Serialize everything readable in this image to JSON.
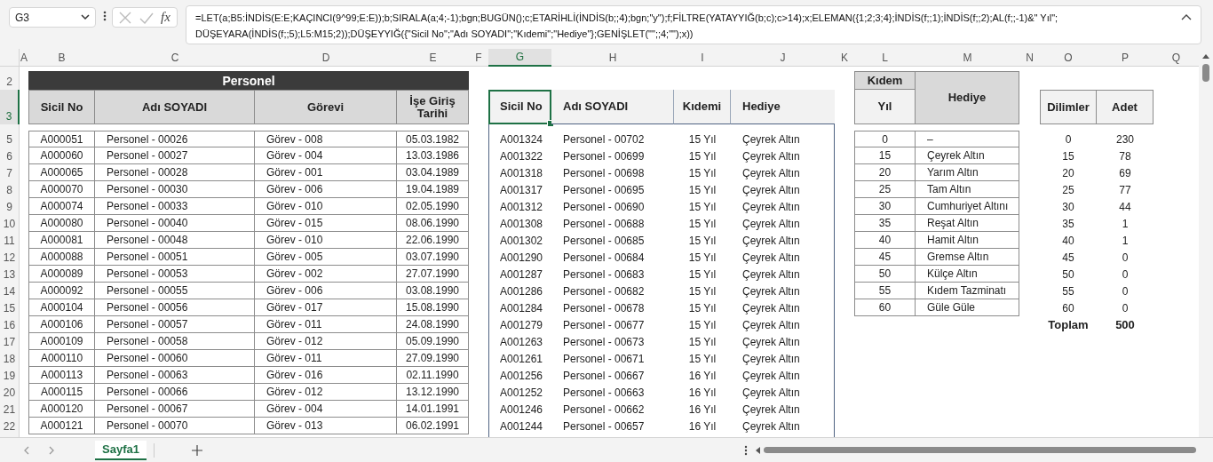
{
  "name_box": "G3",
  "function_label": "fx",
  "formula_lines": [
    "=LET(a;B5:İNDİS(E:E;KAÇINCI(9^99;E:E));b;SIRALA(a;4;-1);bgn;BUGÜN();c;ETARİHLİ(İNDİS(b;;4);bgn;\"y\");f;FİLTRE(YATAYYIĞ(b;c);c>14);x;ELEMAN({1;2;3;4};İNDİS(f;;1);İNDİS(f;;2);AL(f;;-1)&\" Yıl\";",
    "DÜŞEYARA(İNDİS(f;;5);L5:M15;2));DÜŞEYYIĞ({\"Sicil No\";\"Adı SOYADI\";\"Kıdemi\";\"Hediye\"};GENİŞLET(\"\";;4;\"\");x))"
  ],
  "columns": [
    {
      "label": "A",
      "selected": false
    },
    {
      "label": "B",
      "selected": false
    },
    {
      "label": "C",
      "selected": false
    },
    {
      "label": "D",
      "selected": false
    },
    {
      "label": "E",
      "selected": false
    },
    {
      "label": "F",
      "selected": false
    },
    {
      "label": "G",
      "selected": true
    },
    {
      "label": "H",
      "selected": false
    },
    {
      "label": "I",
      "selected": false
    },
    {
      "label": "J",
      "selected": false
    },
    {
      "label": "K",
      "selected": false
    },
    {
      "label": "L",
      "selected": false
    },
    {
      "label": "M",
      "selected": false
    },
    {
      "label": "N",
      "selected": false
    },
    {
      "label": "O",
      "selected": false
    },
    {
      "label": "P",
      "selected": false
    },
    {
      "label": "Q",
      "selected": false
    }
  ],
  "rows": [
    {
      "label": "2",
      "selected": false
    },
    {
      "label": "3",
      "selected": true
    },
    {
      "label": "5",
      "selected": false
    },
    {
      "label": "6",
      "selected": false
    },
    {
      "label": "7",
      "selected": false
    },
    {
      "label": "8",
      "selected": false
    },
    {
      "label": "9",
      "selected": false
    },
    {
      "label": "10",
      "selected": false
    },
    {
      "label": "11",
      "selected": false
    },
    {
      "label": "12",
      "selected": false
    },
    {
      "label": "13",
      "selected": false
    },
    {
      "label": "14",
      "selected": false
    },
    {
      "label": "15",
      "selected": false
    },
    {
      "label": "16",
      "selected": false
    },
    {
      "label": "17",
      "selected": false
    },
    {
      "label": "18",
      "selected": false
    },
    {
      "label": "19",
      "selected": false
    },
    {
      "label": "20",
      "selected": false
    },
    {
      "label": "21",
      "selected": false
    },
    {
      "label": "22",
      "selected": false
    }
  ],
  "personel": {
    "title": "Personel",
    "headers": [
      "Sicil No",
      "Adı SOYADI",
      "Görevi",
      "İşe Giriş Tarihi"
    ],
    "rows": [
      [
        "A000051",
        "Personel - 00026",
        "Görev - 008",
        "05.03.1982"
      ],
      [
        "A000060",
        "Personel - 00027",
        "Görev - 004",
        "13.03.1986"
      ],
      [
        "A000065",
        "Personel - 00028",
        "Görev - 001",
        "03.04.1989"
      ],
      [
        "A000070",
        "Personel - 00030",
        "Görev - 006",
        "19.04.1989"
      ],
      [
        "A000074",
        "Personel - 00033",
        "Görev - 010",
        "02.05.1990"
      ],
      [
        "A000080",
        "Personel - 00040",
        "Görev - 015",
        "08.06.1990"
      ],
      [
        "A000081",
        "Personel - 00048",
        "Görev - 010",
        "22.06.1990"
      ],
      [
        "A000088",
        "Personel - 00051",
        "Görev - 005",
        "03.07.1990"
      ],
      [
        "A000089",
        "Personel - 00053",
        "Görev - 002",
        "27.07.1990"
      ],
      [
        "A000092",
        "Personel - 00055",
        "Görev - 006",
        "03.08.1990"
      ],
      [
        "A000104",
        "Personel - 00056",
        "Görev - 017",
        "15.08.1990"
      ],
      [
        "A000106",
        "Personel - 00057",
        "Görev - 011",
        "24.08.1990"
      ],
      [
        "A000109",
        "Personel - 00058",
        "Görev - 012",
        "05.09.1990"
      ],
      [
        "A000110",
        "Personel - 00060",
        "Görev - 011",
        "27.09.1990"
      ],
      [
        "A000113",
        "Personel - 00063",
        "Görev - 016",
        "02.11.1990"
      ],
      [
        "A000115",
        "Personel - 00066",
        "Görev - 012",
        "13.12.1990"
      ],
      [
        "A000120",
        "Personel - 00067",
        "Görev - 004",
        "14.01.1991"
      ],
      [
        "A000121",
        "Personel - 00070",
        "Görev - 013",
        "06.02.1991"
      ]
    ]
  },
  "results": {
    "headers": [
      {
        "label": "Sicil No",
        "selected": true
      },
      {
        "label": "Adı SOYADI",
        "selected": false
      },
      {
        "label": "Kıdemi",
        "selected": false
      },
      {
        "label": "Hediye",
        "selected": false
      }
    ],
    "rows": [
      [
        "A001324",
        "Personel - 00702",
        "15 Yıl",
        "Çeyrek Altın"
      ],
      [
        "A001322",
        "Personel - 00699",
        "15 Yıl",
        "Çeyrek Altın"
      ],
      [
        "A001318",
        "Personel - 00698",
        "15 Yıl",
        "Çeyrek Altın"
      ],
      [
        "A001317",
        "Personel - 00695",
        "15 Yıl",
        "Çeyrek Altın"
      ],
      [
        "A001312",
        "Personel - 00690",
        "15 Yıl",
        "Çeyrek Altın"
      ],
      [
        "A001308",
        "Personel - 00688",
        "15 Yıl",
        "Çeyrek Altın"
      ],
      [
        "A001302",
        "Personel - 00685",
        "15 Yıl",
        "Çeyrek Altın"
      ],
      [
        "A001290",
        "Personel - 00684",
        "15 Yıl",
        "Çeyrek Altın"
      ],
      [
        "A001287",
        "Personel - 00683",
        "15 Yıl",
        "Çeyrek Altın"
      ],
      [
        "A001286",
        "Personel - 00682",
        "15 Yıl",
        "Çeyrek Altın"
      ],
      [
        "A001284",
        "Personel - 00678",
        "15 Yıl",
        "Çeyrek Altın"
      ],
      [
        "A001279",
        "Personel - 00677",
        "15 Yıl",
        "Çeyrek Altın"
      ],
      [
        "A001263",
        "Personel - 00673",
        "15 Yıl",
        "Çeyrek Altın"
      ],
      [
        "A001261",
        "Personel - 00671",
        "15 Yıl",
        "Çeyrek Altın"
      ],
      [
        "A001256",
        "Personel - 00667",
        "16 Yıl",
        "Çeyrek Altın"
      ],
      [
        "A001252",
        "Personel - 00663",
        "16 Yıl",
        "Çeyrek Altın"
      ],
      [
        "A001246",
        "Personel - 00662",
        "16 Yıl",
        "Çeyrek Altın"
      ],
      [
        "A001244",
        "Personel - 00657",
        "16 Yıl",
        "Çeyrek Altın"
      ]
    ]
  },
  "kidem": {
    "group_header": "Kıdem",
    "year_header": "Yıl",
    "gift_header": "Hediye",
    "rows": [
      [
        "0",
        "–"
      ],
      [
        "15",
        "Çeyrek Altın"
      ],
      [
        "20",
        "Yarım Altın"
      ],
      [
        "25",
        "Tam Altın"
      ],
      [
        "30",
        "Cumhuriyet Altını"
      ],
      [
        "35",
        "Reşat Altın"
      ],
      [
        "40",
        "Hamit Altın"
      ],
      [
        "45",
        "Gremse Altın"
      ],
      [
        "50",
        "Külçe Altın"
      ],
      [
        "55",
        "Kıdem Tazminatı"
      ],
      [
        "60",
        "Güle Güle"
      ]
    ]
  },
  "dilimler": {
    "headers": [
      "Dilimler",
      "Adet"
    ],
    "rows": [
      [
        "0",
        "230"
      ],
      [
        "15",
        "78"
      ],
      [
        "20",
        "69"
      ],
      [
        "25",
        "77"
      ],
      [
        "30",
        "44"
      ],
      [
        "35",
        "1"
      ],
      [
        "40",
        "1"
      ],
      [
        "45",
        "0"
      ],
      [
        "50",
        "0"
      ],
      [
        "55",
        "0"
      ],
      [
        "60",
        "0"
      ]
    ],
    "total_label": "Toplam",
    "total": "500"
  },
  "sheet_tabs": [
    {
      "label": "Sayfa1",
      "selected": true
    }
  ]
}
